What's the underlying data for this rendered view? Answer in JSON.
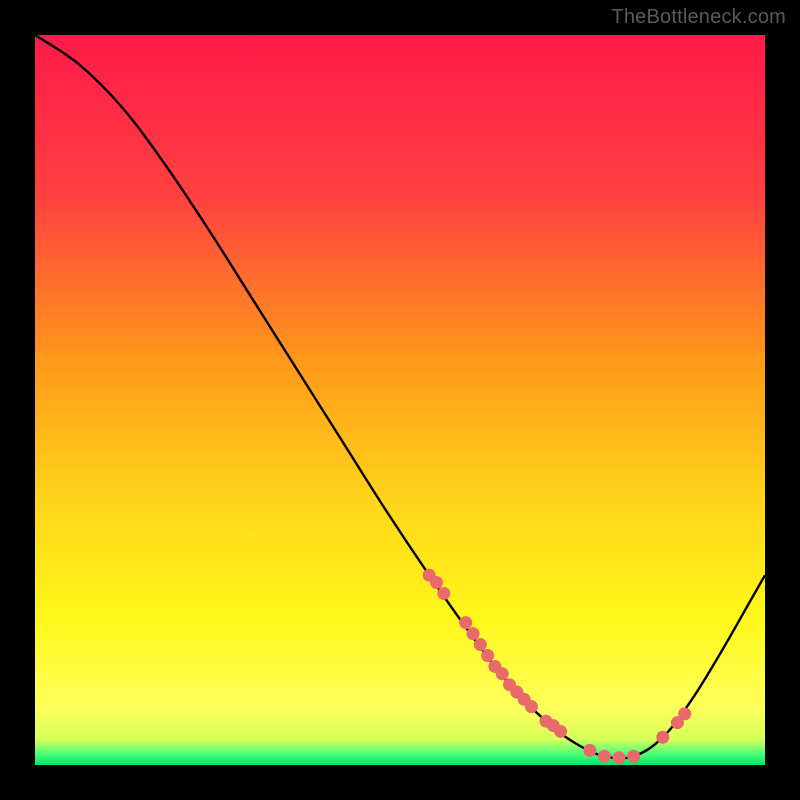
{
  "watermark": "TheBottleneck.com",
  "chart_data": {
    "type": "line",
    "title": "",
    "xlabel": "",
    "ylabel": "",
    "xlim": [
      0,
      100
    ],
    "ylim": [
      0,
      100
    ],
    "grid": false,
    "legend": false,
    "series": [
      {
        "name": "curve",
        "x": [
          0,
          6,
          12,
          18,
          24,
          30,
          36,
          42,
          48,
          54,
          60,
          65,
          70,
          74,
          78,
          82,
          86,
          90,
          94,
          98,
          100
        ],
        "values": [
          100,
          96,
          90,
          82,
          73,
          63.5,
          54,
          44.5,
          35,
          26,
          17.5,
          11,
          6,
          3,
          1.2,
          1.2,
          3.8,
          9,
          15.5,
          22.5,
          26
        ]
      }
    ],
    "dots": {
      "name": "points",
      "x": [
        54,
        55,
        56,
        59,
        60,
        61,
        62,
        63,
        64,
        65,
        66,
        67,
        68,
        70,
        71,
        72,
        76,
        78,
        80,
        82,
        86,
        88,
        89
      ],
      "values": [
        26,
        25,
        23.5,
        19.5,
        18,
        16.5,
        15,
        13.5,
        12.5,
        11,
        10,
        9,
        8,
        6,
        5.4,
        4.6,
        2,
        1.2,
        1.0,
        1.2,
        3.8,
        5.8,
        7.0
      ]
    },
    "gradient_stops": [
      {
        "offset": 0.0,
        "color": "#ff1a4a"
      },
      {
        "offset": 0.22,
        "color": "#ff4040"
      },
      {
        "offset": 0.45,
        "color": "#ff9a1a"
      },
      {
        "offset": 0.63,
        "color": "#ffd21a"
      },
      {
        "offset": 0.8,
        "color": "#fff81a"
      },
      {
        "offset": 0.92,
        "color": "#fffe5a"
      },
      {
        "offset": 0.965,
        "color": "#d6ff5a"
      },
      {
        "offset": 0.985,
        "color": "#4aff7a"
      },
      {
        "offset": 1.0,
        "color": "#00e56a"
      }
    ],
    "dot_color": "#e86a6a",
    "line_color": "#000000"
  }
}
